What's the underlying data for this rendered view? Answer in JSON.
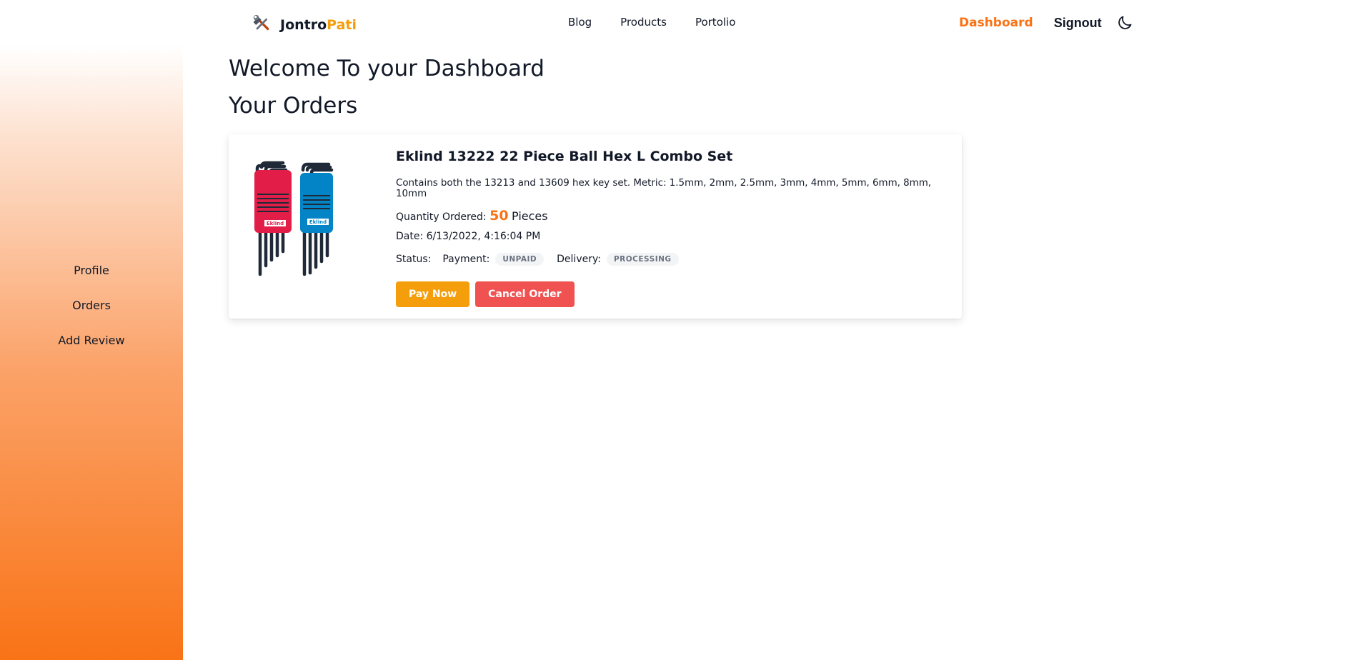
{
  "brand": {
    "name_part1": "Jontro",
    "name_part2": "Pati",
    "logo_icon": "tools-icon"
  },
  "nav": {
    "links": [
      "Blog",
      "Products",
      "Portolio"
    ],
    "dashboard": "Dashboard",
    "signout": "Signout",
    "theme_icon": "moon-icon"
  },
  "sidebar": {
    "items": [
      "Profile",
      "Orders",
      "Add Review"
    ]
  },
  "main": {
    "welcome": "Welcome To your Dashboard",
    "orders_title": "Your Orders"
  },
  "order": {
    "title": "Eklind 13222 22 Piece Ball Hex L Combo Set",
    "description": "Contains both the 13213 and 13609 hex key set. Metric: 1.5mm, 2mm, 2.5mm, 3mm, 4mm, 5mm, 6mm, 8mm, 10mm",
    "quantity_label": "Quantity Ordered:",
    "quantity": "50",
    "quantity_unit": "Pieces",
    "date_label": "Date:",
    "date": "6/13/2022, 4:16:04 PM",
    "status_label": "Status:",
    "payment_label": "Payment:",
    "payment_status": "UNPAID",
    "delivery_label": "Delivery:",
    "delivery_status": "PROCESSING",
    "pay_button": "Pay Now",
    "cancel_button": "Cancel Order",
    "image_brand_text": "Eklind"
  },
  "colors": {
    "accent": "#f97316",
    "pay": "#f59e0b",
    "cancel": "#f05252"
  }
}
